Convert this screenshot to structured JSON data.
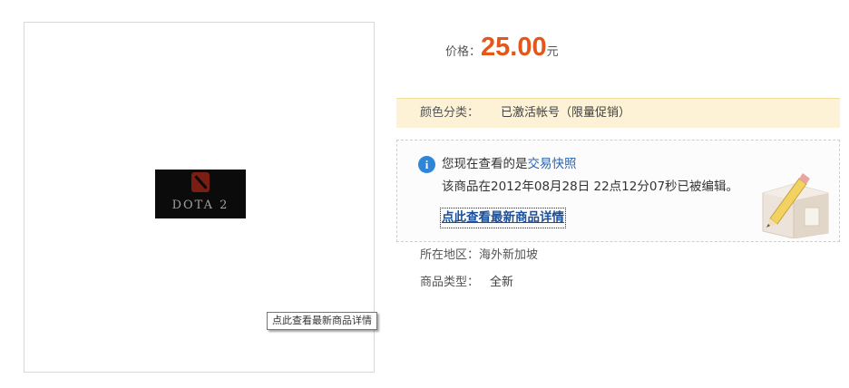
{
  "product_image": {
    "text": "DOTA 2"
  },
  "tooltip": "点此查看最新商品详情",
  "price": {
    "label": "价格：",
    "value": "25.00",
    "unit": "元"
  },
  "color": {
    "label": "颜色分类：",
    "value": "已激活帐号（限量促销）"
  },
  "snapshot": {
    "notice_prefix": "您现在查看的是",
    "notice_link": "交易快照",
    "edit_info": "该商品在2012年08月28日  22点12分07秒已被编辑。",
    "view_latest": "点此查看最新商品详情",
    "icon": "info-icon"
  },
  "region": {
    "label": "所在地区：",
    "value": "海外新加坡"
  },
  "item_type": {
    "label": "商品类型：",
    "value": "全新"
  },
  "colors": {
    "price": "#e4571a",
    "link": "#2a63b2",
    "highlight": "#fdf2d6"
  }
}
